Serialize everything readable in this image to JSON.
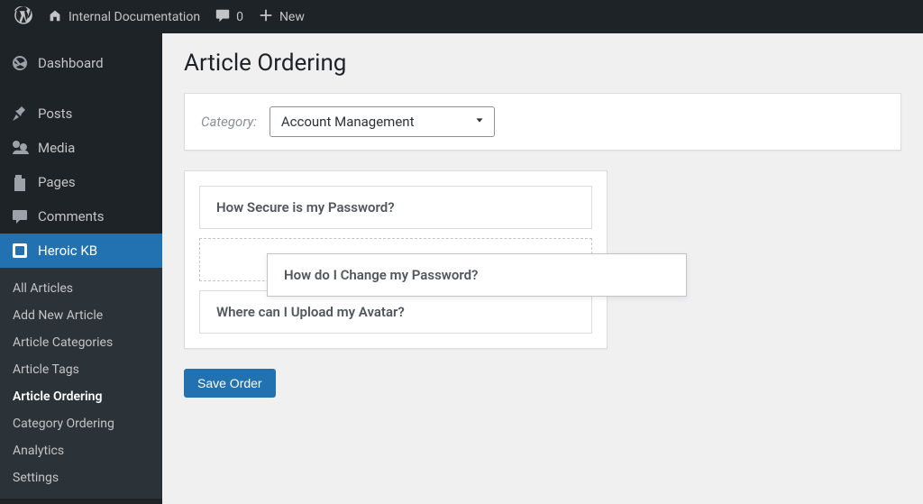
{
  "adminbar": {
    "site_title": "Internal Documentation",
    "comments_count": "0",
    "new_label": "New"
  },
  "sidebar": {
    "items": [
      {
        "id": "dashboard",
        "label": "Dashboard",
        "icon": "dashboard"
      },
      {
        "id": "posts",
        "label": "Posts",
        "icon": "pin"
      },
      {
        "id": "media",
        "label": "Media",
        "icon": "media"
      },
      {
        "id": "pages",
        "label": "Pages",
        "icon": "pages"
      },
      {
        "id": "comments",
        "label": "Comments",
        "icon": "comment"
      },
      {
        "id": "heroickb",
        "label": "Heroic KB",
        "icon": "kb",
        "active": true
      }
    ],
    "submenu": [
      {
        "label": "All Articles"
      },
      {
        "label": "Add New Article"
      },
      {
        "label": "Article Categories"
      },
      {
        "label": "Article Tags"
      },
      {
        "label": "Article Ordering",
        "current": true
      },
      {
        "label": "Category Ordering"
      },
      {
        "label": "Analytics"
      },
      {
        "label": "Settings"
      }
    ]
  },
  "page": {
    "title": "Article Ordering",
    "category_label": "Category:",
    "category_selected": "Account Management",
    "save_button": "Save Order"
  },
  "articles": [
    {
      "title": "How Secure is my Password?"
    },
    {
      "title": "How do I Change my Password?",
      "dragging": true
    },
    {
      "title": "Where can I Upload my Avatar?"
    }
  ]
}
